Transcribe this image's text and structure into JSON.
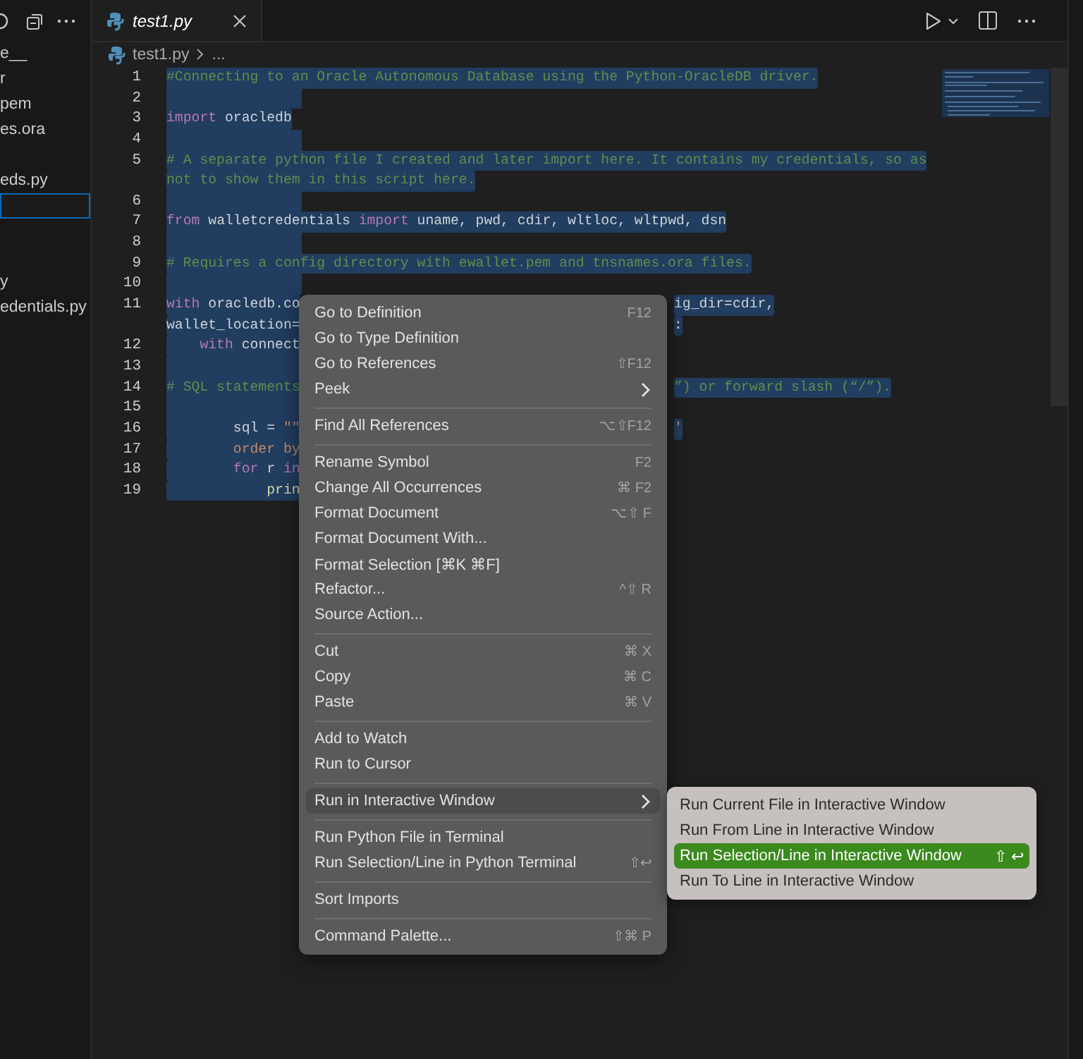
{
  "explorer": {
    "files": [
      {
        "label": "e__",
        "selected": false
      },
      {
        "label": "r",
        "selected": false
      },
      {
        "label": "pem",
        "selected": false
      },
      {
        "label": "es.ora",
        "selected": false
      },
      {
        "selected": false
      },
      {
        "label": "eds.py",
        "selected": false
      },
      {
        "selected": true
      },
      {
        "selected": false
      },
      {
        "selected": false
      },
      {
        "label": "y",
        "selected": false
      },
      {
        "label": "edentials.py",
        "selected": false
      }
    ]
  },
  "tabs": [
    {
      "label": "test1.py",
      "selected": true
    }
  ],
  "breadcrumb": [
    "test1.py",
    "..."
  ],
  "code_lines": [
    {
      "number": "1",
      "segments": [
        {
          "kind": "comment",
          "text": "#Connecting to an Oracle Autonomous Database using the Python-OracleDB driver."
        }
      ]
    },
    {
      "number": "2"
    },
    {
      "number": "3",
      "segments": [
        {
          "kind": "keyword",
          "text": "import"
        },
        {
          "kind": "plain",
          "text": " oracledb"
        }
      ]
    },
    {
      "number": "4"
    },
    {
      "number": "5",
      "segments": [
        {
          "kind": "comment",
          "text": "# A separate python file I created and later import here. It contains my credentials, so as"
        }
      ]
    },
    {
      "segments": [
        {
          "kind": "comment",
          "text": "not to show them in this script here."
        }
      ]
    },
    {
      "number": "6"
    },
    {
      "number": "7",
      "segments": [
        {
          "kind": "keyword",
          "text": "from"
        },
        {
          "kind": "plain",
          "text": " walletcredentials "
        },
        {
          "kind": "keyword",
          "text": "import"
        },
        {
          "kind": "plain",
          "text": " uname, pwd, cdir, wltloc, wltpwd, dsn"
        }
      ]
    },
    {
      "number": "8"
    },
    {
      "number": "9",
      "segments": [
        {
          "kind": "comment",
          "text": "# Requires a config directory with ewallet.pem and tnsnames.ora files."
        }
      ]
    },
    {
      "number": "10"
    },
    {
      "number": "11",
      "segments": [
        {
          "kind": "keyword",
          "text": "with"
        },
        {
          "kind": "plain",
          "text": " oracledb.co"
        }
      ],
      "right": [
        {
          "kind": "plain",
          "text": "ig_dir=cdir,"
        }
      ]
    },
    {
      "segments": [
        {
          "kind": "plain",
          "text": "wallet_location="
        }
      ],
      "right": [
        {
          "kind": "plain",
          "text": ":"
        }
      ]
    },
    {
      "number": "12",
      "segments": [
        {
          "kind": "keyword",
          "text": "    with"
        },
        {
          "kind": "plain",
          "text": " connect"
        }
      ]
    },
    {
      "number": "13"
    },
    {
      "number": "14",
      "segments": [
        {
          "kind": "comment",
          "text": "# SQL statements"
        }
      ],
      "right": [
        {
          "kind": "comment",
          "text": "”) or forward slash (“/”)."
        }
      ]
    },
    {
      "number": "15"
    },
    {
      "number": "16",
      "segments": [
        {
          "kind": "plain",
          "text": "        sql = "
        },
        {
          "kind": "string",
          "text": "\"\""
        }
      ],
      "right": [
        {
          "kind": "string",
          "text": "'"
        }
      ]
    },
    {
      "number": "17",
      "segments": [
        {
          "kind": "string",
          "text": "        order by"
        }
      ]
    },
    {
      "number": "18",
      "segments": [
        {
          "kind": "keyword",
          "text": "        for"
        },
        {
          "kind": "plain",
          "text": " r "
        },
        {
          "kind": "keyword",
          "text": "in"
        }
      ]
    },
    {
      "number": "19",
      "segments": [
        {
          "kind": "function",
          "text": "            prin"
        }
      ]
    }
  ],
  "context_menu": {
    "items": [
      {
        "kind": "item",
        "label": "Go to Definition",
        "shortcut": "F12",
        "selected": false
      },
      {
        "kind": "item",
        "label": "Go to Type Definition",
        "selected": false
      },
      {
        "kind": "item",
        "label": "Go to References",
        "shortcut": "⇧F12",
        "selected": false
      },
      {
        "kind": "item",
        "label": "Peek",
        "has_submenu": true,
        "selected": false
      },
      {
        "kind": "separator"
      },
      {
        "kind": "item",
        "label": "Find All References",
        "shortcut": "⌥⇧F12",
        "selected": false
      },
      {
        "kind": "separator"
      },
      {
        "kind": "item",
        "label": "Rename Symbol",
        "shortcut": "F2",
        "selected": false
      },
      {
        "kind": "item",
        "label": "Change All Occurrences",
        "shortcut": "⌘ F2",
        "selected": false
      },
      {
        "kind": "item",
        "label": "Format Document",
        "shortcut": "⌥⇧ F",
        "selected": false
      },
      {
        "kind": "item",
        "label": "Format Document With...",
        "selected": false
      },
      {
        "kind": "item",
        "label": "Format Selection [⌘K ⌘F]",
        "selected": false
      },
      {
        "kind": "item",
        "label": "Refactor...",
        "shortcut": "^⇧ R",
        "selected": false
      },
      {
        "kind": "item",
        "label": "Source Action...",
        "selected": false
      },
      {
        "kind": "separator"
      },
      {
        "kind": "item",
        "label": "Cut",
        "shortcut": "⌘ X",
        "selected": false
      },
      {
        "kind": "item",
        "label": "Copy",
        "shortcut": "⌘ C",
        "selected": false
      },
      {
        "kind": "item",
        "label": "Paste",
        "shortcut": "⌘ V",
        "selected": false
      },
      {
        "kind": "separator"
      },
      {
        "kind": "item",
        "label": "Add to Watch",
        "selected": false
      },
      {
        "kind": "item",
        "label": "Run to Cursor",
        "selected": false
      },
      {
        "kind": "separator"
      },
      {
        "kind": "item",
        "label": "Run in Interactive Window",
        "has_submenu": true,
        "selected": true
      },
      {
        "kind": "separator"
      },
      {
        "kind": "item",
        "label": "Run Python File in Terminal",
        "selected": false
      },
      {
        "kind": "item",
        "label": "Run Selection/Line in Python Terminal",
        "shortcut": "⇧↩",
        "selected": false
      },
      {
        "kind": "separator"
      },
      {
        "kind": "item",
        "label": "Sort Imports",
        "selected": false
      },
      {
        "kind": "separator"
      },
      {
        "kind": "item",
        "label": "Command Palette...",
        "shortcut": "⇧⌘ P",
        "selected": false
      }
    ]
  },
  "submenu": {
    "items": [
      {
        "label": "Run Current File in Interactive Window",
        "selected": false
      },
      {
        "label": "Run From Line in Interactive Window",
        "selected": false
      },
      {
        "label": "Run Selection/Line in Interactive Window",
        "shortcut": "⇧ ↩",
        "selected": true
      },
      {
        "label": "Run To Line in Interactive Window",
        "selected": false
      }
    ]
  }
}
